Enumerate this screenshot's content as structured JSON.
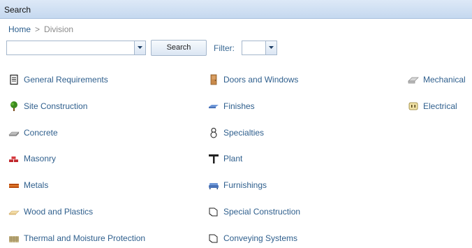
{
  "window": {
    "title": "Search"
  },
  "breadcrumb": {
    "home": "Home",
    "separator": ">",
    "current": "Division"
  },
  "search": {
    "value": "",
    "placeholder": "",
    "button_label": "Search"
  },
  "filter": {
    "label": "Filter:",
    "value": ""
  },
  "divisions": {
    "col1": [
      {
        "label": "General Requirements",
        "icon": "document-icon"
      },
      {
        "label": "Site Construction",
        "icon": "tree-icon"
      },
      {
        "label": "Concrete",
        "icon": "concrete-slab-icon"
      },
      {
        "label": "Masonry",
        "icon": "bricks-icon"
      },
      {
        "label": "Metals",
        "icon": "steel-beam-icon"
      },
      {
        "label": "Wood and Plastics",
        "icon": "lumber-icon"
      },
      {
        "label": "Thermal and Moisture Protection",
        "icon": "insulation-icon"
      }
    ],
    "col2": [
      {
        "label": "Doors and Windows",
        "icon": "door-icon"
      },
      {
        "label": "Finishes",
        "icon": "paint-swatch-icon"
      },
      {
        "label": "Specialties",
        "icon": "snowman-icon"
      },
      {
        "label": "Plant",
        "icon": "hammer-icon"
      },
      {
        "label": "Furnishings",
        "icon": "sofa-icon"
      },
      {
        "label": "Special Construction",
        "icon": "folder-outline-icon"
      },
      {
        "label": "Conveying Systems",
        "icon": "folder-outline-icon"
      }
    ],
    "col3": [
      {
        "label": "Mechanical",
        "icon": "pipe-icon"
      },
      {
        "label": "Electrical",
        "icon": "outlet-icon"
      }
    ]
  }
}
